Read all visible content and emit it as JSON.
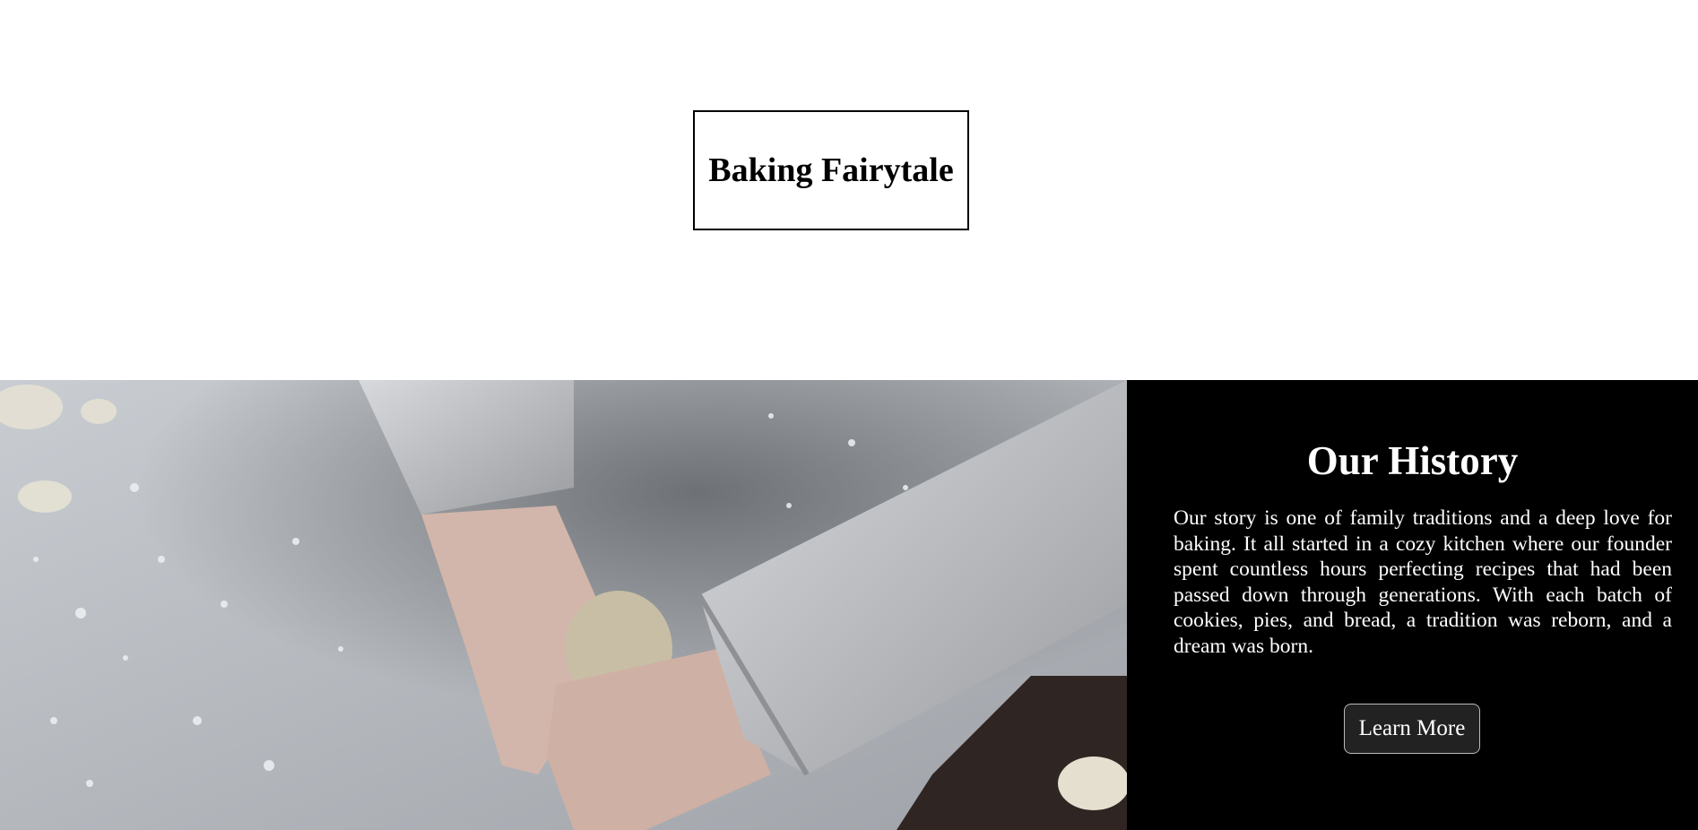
{
  "header": {
    "logo_text": "Baking Fairytale"
  },
  "history": {
    "title": "Our History",
    "body": "Our story is one of family traditions and a deep love for baking. It all started in a cozy kitchen where our founder spent countless hours perfecting recipes that had been passed down through generations. With each batch of cookies, pies, and bread, a tradition was reborn, and a dream was born.",
    "button_label": "Learn More"
  },
  "colors": {
    "page_background": "#ffffff",
    "history_background": "#000000",
    "history_text": "#ffffff",
    "button_background": "#222222"
  }
}
